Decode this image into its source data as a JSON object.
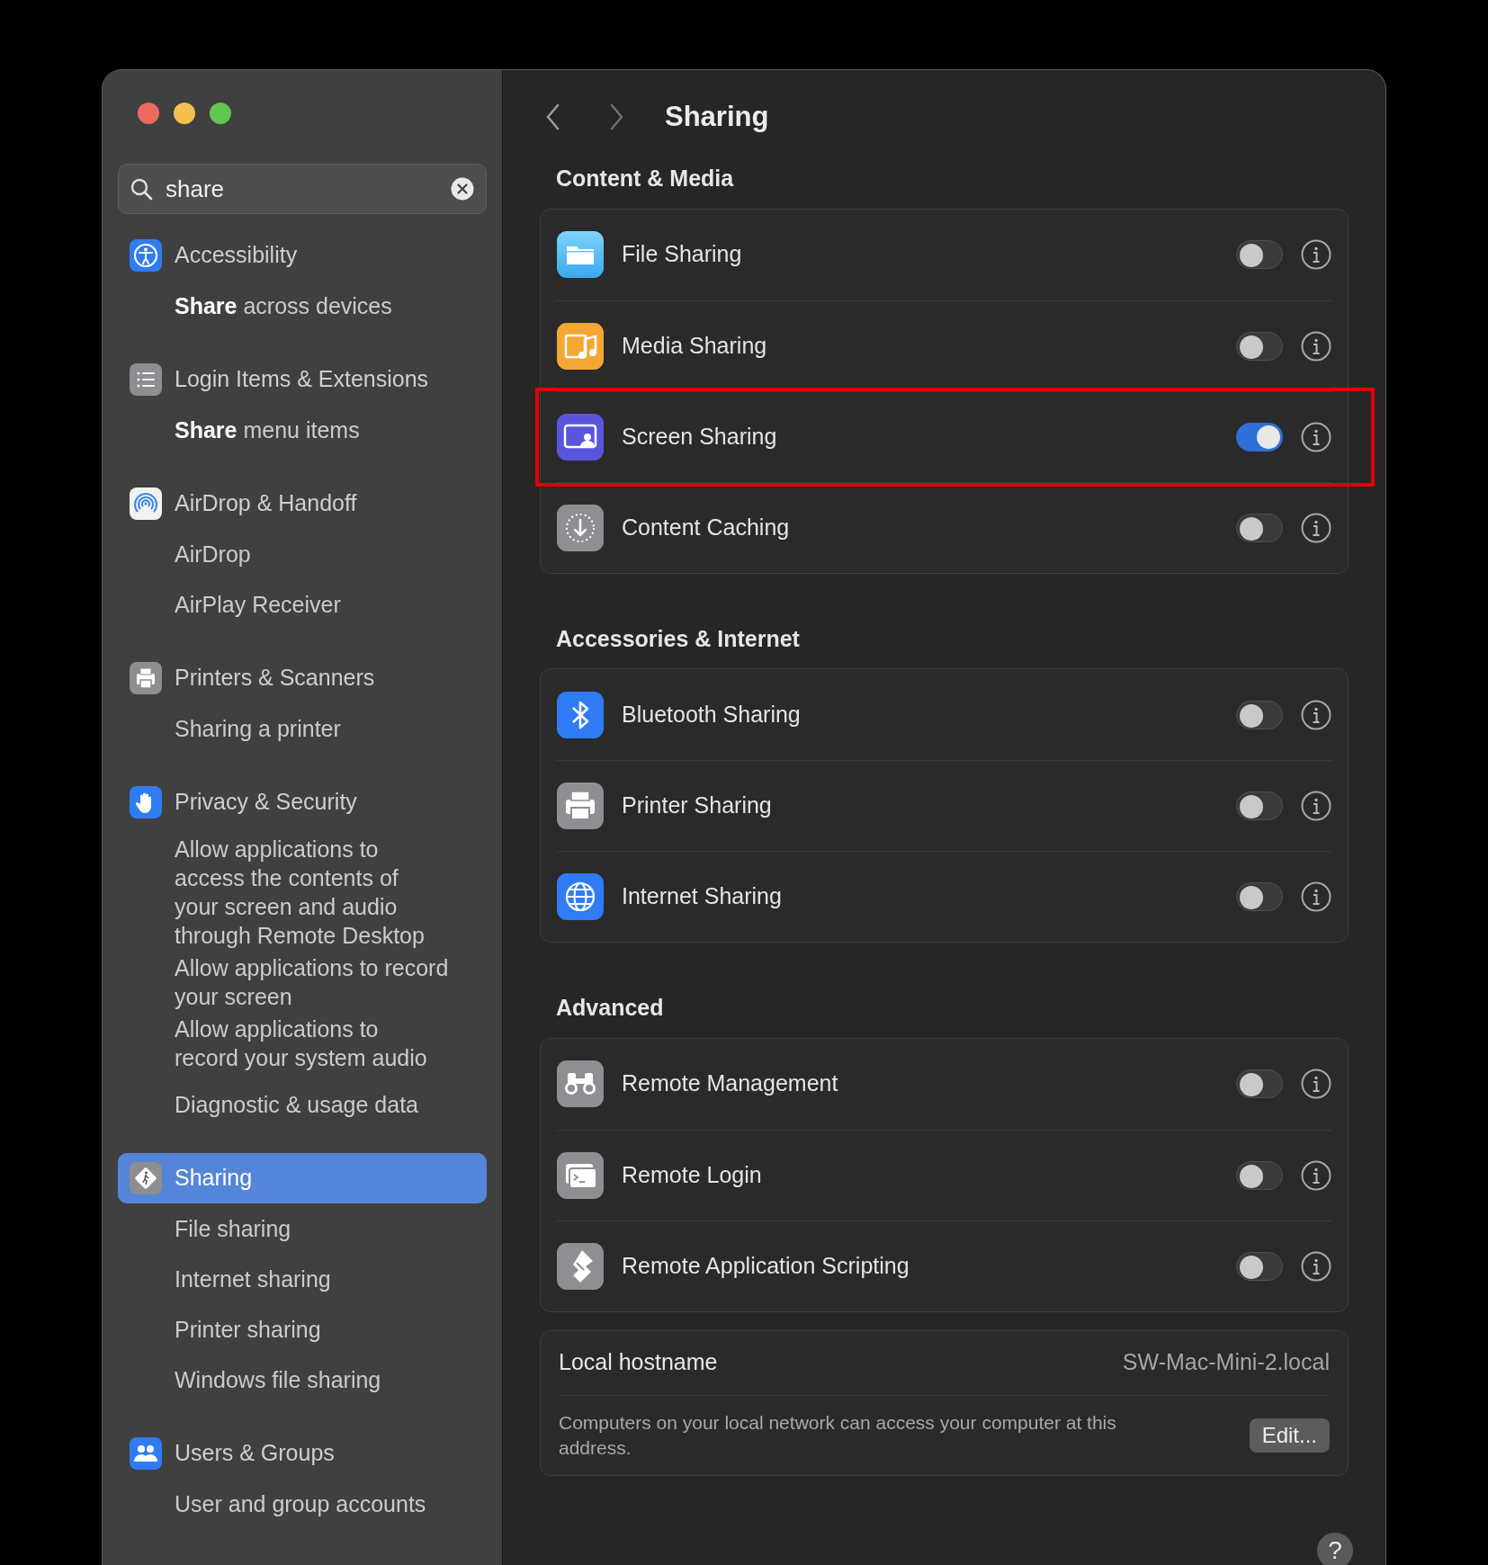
{
  "search": {
    "value": "share"
  },
  "sidebar": {
    "groups": [
      {
        "label": "Accessibility",
        "selected": false,
        "items": [
          "**Share** across devices"
        ]
      },
      {
        "label": "Login Items & Extensions",
        "selected": false,
        "items": [
          "**Share** menu items"
        ]
      },
      {
        "label": "AirDrop & Handoff",
        "selected": false,
        "items": [
          "AirDrop",
          "AirPlay Receiver"
        ]
      },
      {
        "label": "Printers & Scanners",
        "selected": false,
        "items": [
          "Sharing a printer"
        ]
      },
      {
        "label": "Privacy & Security",
        "selected": false,
        "items": [
          "Allow applications to access the contents of your screen and audio through Remote Desktop",
          "Allow applications to record your screen",
          "Allow applications to record your system audio",
          "Diagnostic & usage data"
        ]
      },
      {
        "label": "Sharing",
        "selected": true,
        "items": [
          "File sharing",
          "Internet sharing",
          "Printer sharing",
          "Windows file sharing"
        ]
      },
      {
        "label": "Users & Groups",
        "selected": false,
        "items": [
          "User and group accounts"
        ]
      }
    ]
  },
  "title": "Sharing",
  "sections": [
    {
      "title": "Content & Media",
      "rows": [
        {
          "label": "File Sharing",
          "on": false,
          "highlighted": false
        },
        {
          "label": "Media Sharing",
          "on": false,
          "highlighted": false
        },
        {
          "label": "Screen Sharing",
          "on": true,
          "highlighted": true
        },
        {
          "label": "Content Caching",
          "on": false,
          "highlighted": false
        }
      ]
    },
    {
      "title": "Accessories & Internet",
      "rows": [
        {
          "label": "Bluetooth Sharing",
          "on": false,
          "highlighted": false
        },
        {
          "label": "Printer Sharing",
          "on": false,
          "highlighted": false
        },
        {
          "label": "Internet Sharing",
          "on": false,
          "highlighted": false
        }
      ]
    },
    {
      "title": "Advanced",
      "rows": [
        {
          "label": "Remote Management",
          "on": false,
          "highlighted": false
        },
        {
          "label": "Remote Login",
          "on": false,
          "highlighted": false
        },
        {
          "label": "Remote Application Scripting",
          "on": false,
          "highlighted": false
        }
      ]
    }
  ],
  "hostname": {
    "label": "Local hostname",
    "value": "SW-Mac-Mini-2.local",
    "description": "Computers on your local network can access your computer at this address.",
    "button": "Edit..."
  },
  "help_button": "?"
}
